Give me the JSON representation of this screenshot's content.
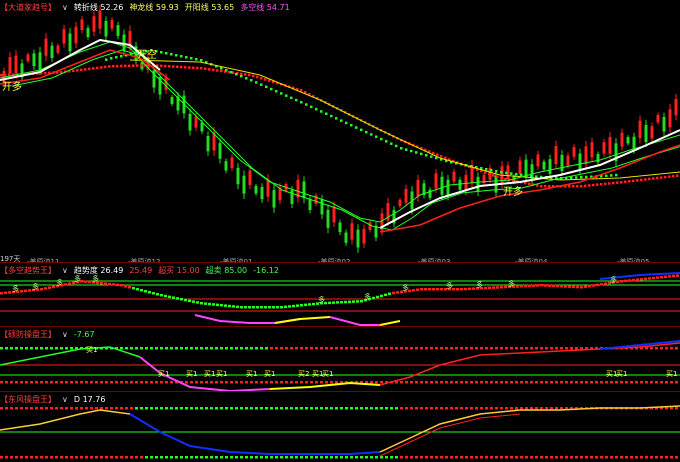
{
  "main": {
    "title": "【大道家趋号】",
    "chev": "∨",
    "items": [
      {
        "label": "转折线",
        "value": "52.26",
        "color": "#ffffff"
      },
      {
        "label": "神龙线",
        "value": "59.93",
        "color": "#ffff66"
      },
      {
        "label": "开阳线",
        "value": "53.65",
        "color": "#ffff66"
      },
      {
        "label": "多空线",
        "value": "54.71",
        "color": "#ff55ff"
      }
    ],
    "signals": [
      "开多",
      "开空",
      "开多"
    ],
    "vol_label": "197天",
    "dates": [
      "-美原油11",
      "-美原油12",
      "-美原油01",
      "-美原油02",
      "-美原油03",
      "-美原油04",
      "-美原油05"
    ]
  },
  "p2": {
    "title": "【多空趋势王】",
    "chev": "∨",
    "items": [
      {
        "label": "趋势度",
        "value": "26.49",
        "color": "#ffffff"
      },
      {
        "label": "",
        "value": "25.49",
        "color": "#ff4040"
      },
      {
        "label": "超买",
        "value": "15.00",
        "color": "#ff4040"
      },
      {
        "label": "超卖",
        "value": "85.00",
        "color": "#44ff44"
      },
      {
        "label": "",
        "value": "-16.12",
        "color": "#44ff44"
      }
    ],
    "marks": [
      "多",
      "多",
      "多",
      "多",
      "多",
      "多",
      "多",
      "多",
      "多",
      "多",
      "多",
      "多"
    ]
  },
  "p3": {
    "title": "【硕防操盘王】",
    "chev": "∨",
    "items": [
      {
        "label": "",
        "value": "-7.67",
        "color": "#44ff44"
      }
    ],
    "buys": [
      "买1",
      "买1",
      "买1",
      "买1",
      "买1",
      "买1",
      "买2",
      "买1",
      "买1",
      "买1",
      "买1",
      "买1",
      "买1"
    ]
  },
  "p4": {
    "title": "【东风操盘王】",
    "chev": "∨",
    "items": [
      {
        "label": "D",
        "value": "17.76",
        "color": "#ffffff"
      }
    ]
  },
  "colors": {
    "up": "#ff2020",
    "down": "#22dd22",
    "white": "#ffffff",
    "yellow": "#ffff00",
    "blue": "#1030ff",
    "magenta": "#ff44ff",
    "red": "#ff2020",
    "green": "#22ff22"
  }
}
